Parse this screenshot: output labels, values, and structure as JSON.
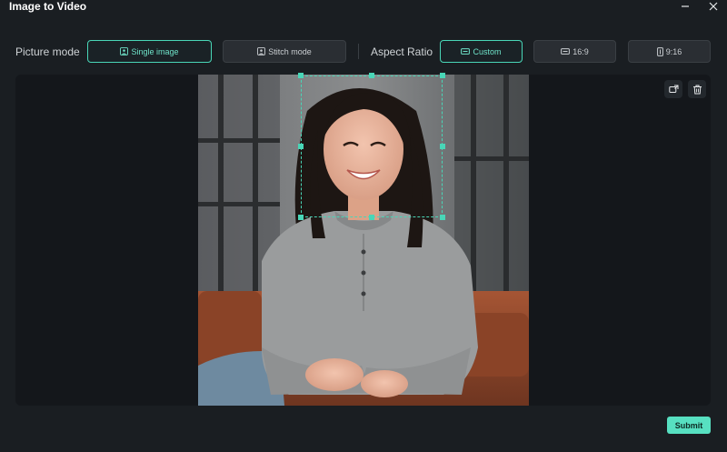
{
  "window": {
    "title": "Image to Video"
  },
  "picture_mode": {
    "label": "Picture mode",
    "options": [
      {
        "label": "Single image",
        "active": true,
        "icon": "image-icon"
      },
      {
        "label": "Stitch mode",
        "active": false,
        "icon": "image-icon"
      }
    ]
  },
  "aspect_ratio": {
    "label": "Aspect Ratio",
    "options": [
      {
        "label": "Custom",
        "active": true,
        "icon": "custom-ratio-icon"
      },
      {
        "label": "16:9",
        "active": false,
        "icon": "landscape-ratio-icon"
      },
      {
        "label": "9:16",
        "active": false,
        "icon": "portrait-ratio-icon"
      }
    ]
  },
  "canvas": {
    "tools": [
      "replace-image-icon",
      "trash-icon"
    ]
  },
  "footer": {
    "submit_label": "Submit"
  },
  "colors": {
    "accent": "#49d6b7",
    "background": "#1a1e22",
    "canvas": "#14171b"
  }
}
